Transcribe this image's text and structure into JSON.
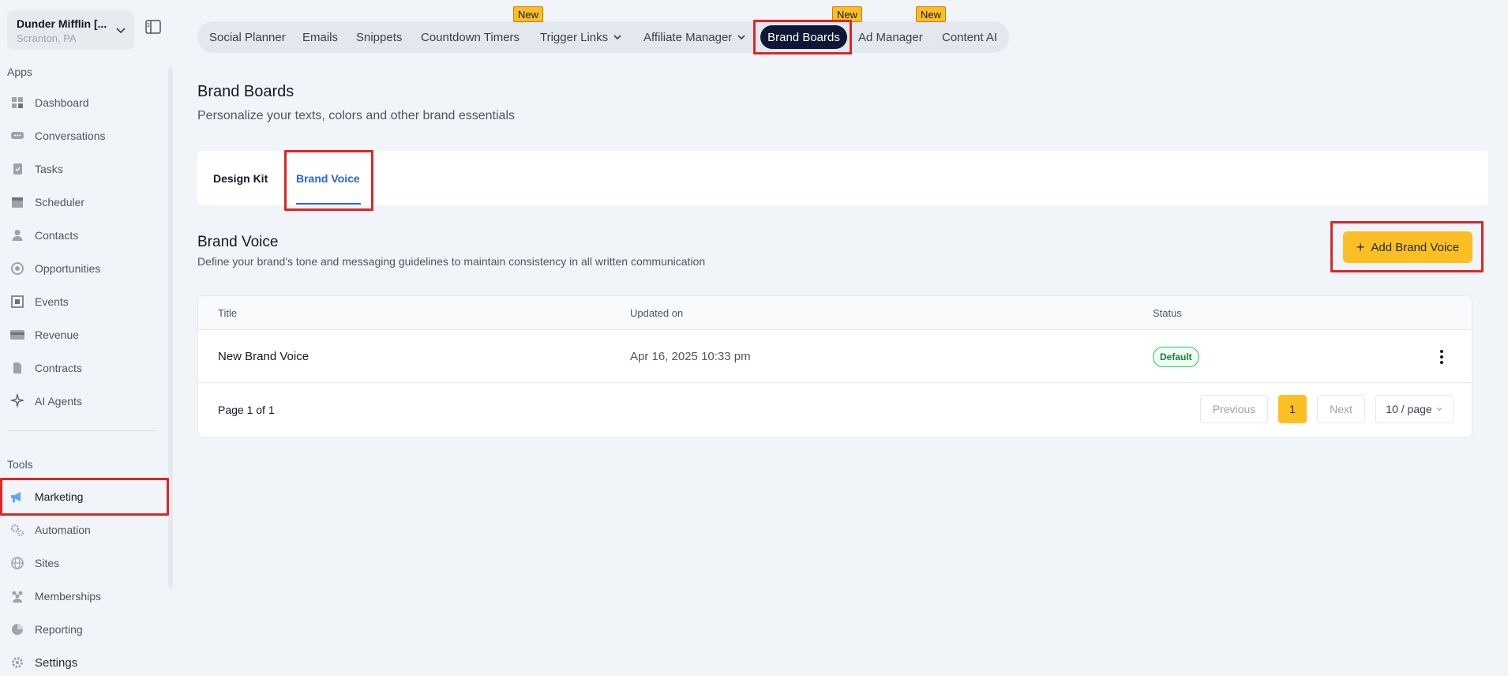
{
  "sidebar": {
    "location_name": "Dunder Mifflin [...",
    "location_sub": "Scranton, PA",
    "apps_label": "Apps",
    "tools_label": "Tools",
    "apps": [
      {
        "label": "Dashboard",
        "icon": "dashboard-icon"
      },
      {
        "label": "Conversations",
        "icon": "chat-icon"
      },
      {
        "label": "Tasks",
        "icon": "tasks-icon"
      },
      {
        "label": "Scheduler",
        "icon": "calendar-icon"
      },
      {
        "label": "Contacts",
        "icon": "person-icon"
      },
      {
        "label": "Opportunities",
        "icon": "target-icon"
      },
      {
        "label": "Events",
        "icon": "events-icon"
      },
      {
        "label": "Revenue",
        "icon": "card-icon"
      },
      {
        "label": "Contracts",
        "icon": "document-icon"
      },
      {
        "label": "AI Agents",
        "icon": "sparkle-icon"
      }
    ],
    "tools": [
      {
        "label": "Marketing",
        "icon": "megaphone-icon"
      },
      {
        "label": "Automation",
        "icon": "gears-icon"
      },
      {
        "label": "Sites",
        "icon": "globe-icon"
      },
      {
        "label": "Memberships",
        "icon": "group-icon"
      },
      {
        "label": "Reporting",
        "icon": "pie-icon"
      },
      {
        "label": "Settings",
        "icon": "gear-icon"
      }
    ]
  },
  "topnav": {
    "items": [
      "Social Planner",
      "Emails",
      "Snippets",
      "Countdown Timers",
      "Trigger Links",
      "Affiliate Manager",
      "Brand Boards",
      "Ad Manager",
      "Content AI"
    ],
    "active": "Brand Boards",
    "new_badge": "New"
  },
  "header": {
    "title": "Brand Boards",
    "subtitle": "Personalize your texts, colors and other brand essentials"
  },
  "tabs": {
    "design_kit": "Design Kit",
    "brand_voice": "Brand Voice"
  },
  "section": {
    "title": "Brand Voice",
    "subtitle": "Define your brand's tone and messaging guidelines to maintain consistency in all written communication",
    "add_button": "Add Brand Voice"
  },
  "table": {
    "columns": [
      "Title",
      "Updated on",
      "Status"
    ],
    "rows": [
      {
        "title": "New Brand Voice",
        "updated": "Apr 16, 2025 10:33 pm",
        "status": "Default"
      }
    ],
    "pager_text": "Page 1 of 1",
    "previous": "Previous",
    "current_page": "1",
    "next": "Next",
    "page_size": "10 / page"
  },
  "colors": {
    "accent": "#fbbf24",
    "active_nav": "#0f1736",
    "link_blue": "#2563eb",
    "highlight_red": "#dc2626",
    "status_green": "#22c55e"
  }
}
